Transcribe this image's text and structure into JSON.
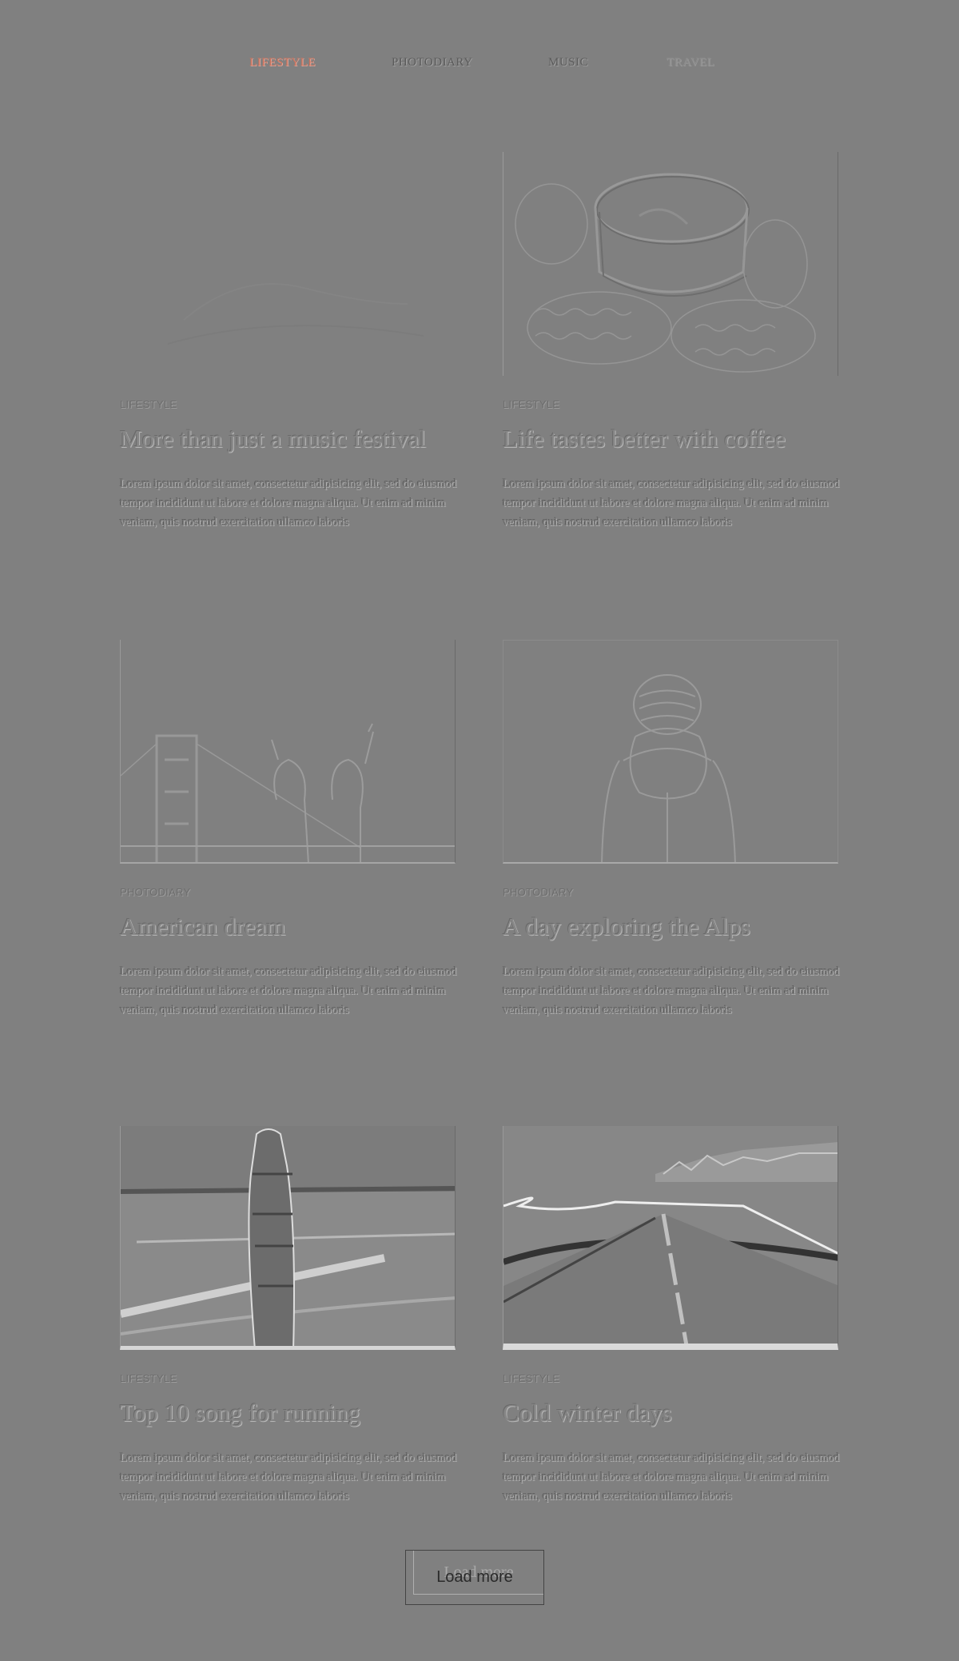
{
  "nav": {
    "items": [
      {
        "label": "LIFESTYLE"
      },
      {
        "label": "PHOTODIARY"
      },
      {
        "label": "MUSIC"
      },
      {
        "label": "TRAVEL"
      }
    ],
    "active_color": "#c9735e"
  },
  "posts": [
    {
      "category": "LIFESTYLE",
      "title": "More than just a music festival",
      "excerpt": "Lorem ipsum dolor sit amet, consectetur adipisicing elit, sed do eiusmod tempor incididunt ut labore et dolore magna aliqua. Ut enim ad minim veniam, quis nostrud exercitation ullamco laboris"
    },
    {
      "category": "LIFESTYLE",
      "title": "Life tastes better with coffee",
      "excerpt": "Lorem ipsum dolor sit amet, consectetur adipisicing elit, sed do eiusmod tempor incididunt ut labore et dolore magna aliqua. Ut enim ad minim veniam, quis nostrud exercitation ullamco laboris"
    },
    {
      "category": "PHOTODIARY",
      "title": "American dream",
      "excerpt": "Lorem ipsum dolor sit amet, consectetur adipisicing elit, sed do eiusmod tempor incididunt ut labore et dolore magna aliqua. Ut enim ad minim veniam, quis nostrud exercitation ullamco laboris"
    },
    {
      "category": "PHOTODIARY",
      "title": "A day exploring the Alps",
      "excerpt": "Lorem ipsum dolor sit amet, consectetur adipisicing elit, sed do eiusmod tempor incididunt ut labore et dolore magna aliqua. Ut enim ad minim veniam, quis nostrud exercitation ullamco laboris"
    },
    {
      "category": "LIFESTYLE",
      "title": "Top 10 song for running",
      "excerpt": "Lorem ipsum dolor sit amet, consectetur adipisicing elit, sed do eiusmod tempor incididunt ut labore et dolore magna aliqua. Ut enim ad minim veniam, quis nostrud exercitation ullamco laboris"
    },
    {
      "category": "LIFESTYLE",
      "title": "Cold winter days",
      "excerpt": "Lorem ipsum dolor sit amet, consectetur adipisicing elit, sed do eiusmod tempor incididunt ut labore et dolore magna aliqua. Ut enim ad minim veniam, quis nostrud exercitation ullamco laboris"
    }
  ],
  "load_more": {
    "label": "Load more"
  }
}
